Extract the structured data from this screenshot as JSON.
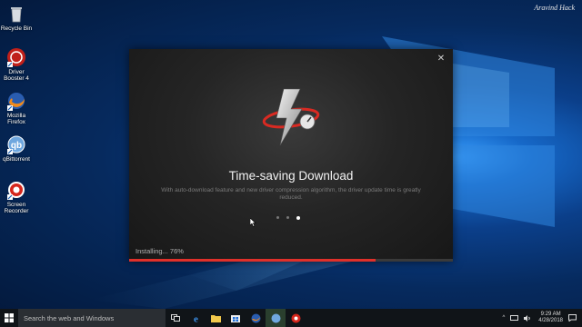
{
  "watermark": "Aravind Hack",
  "desktop_icons": [
    {
      "name": "recycle-bin",
      "label": "Recycle Bin"
    },
    {
      "name": "driver-booster",
      "label": "Driver Booster 4"
    },
    {
      "name": "mozilla-firefox",
      "label": "Mozilla Firefox"
    },
    {
      "name": "qbittorrent",
      "label": "qBittorrent"
    },
    {
      "name": "screen-recorder",
      "label": "Screen Recorder"
    }
  ],
  "dialog": {
    "close_glyph": "✕",
    "title": "Time-saving Download",
    "description": "With auto-download feature and new driver compression algorithm, the driver update time is greatly reduced.",
    "slides": {
      "count": 3,
      "active_index": 2
    },
    "status": "Installing... 76%",
    "progress": 0.76,
    "accent_color": "#e0302a"
  },
  "taskbar": {
    "search_placeholder": "Search the web and Windows",
    "apps": [
      "task-view-icon",
      "edge-icon",
      "file-explorer-icon",
      "store-icon",
      "firefox-icon",
      "qbittorrent-icon",
      "screen-recorder-icon"
    ],
    "clock_time": "9:29 AM",
    "clock_date": "4/28/2018"
  }
}
